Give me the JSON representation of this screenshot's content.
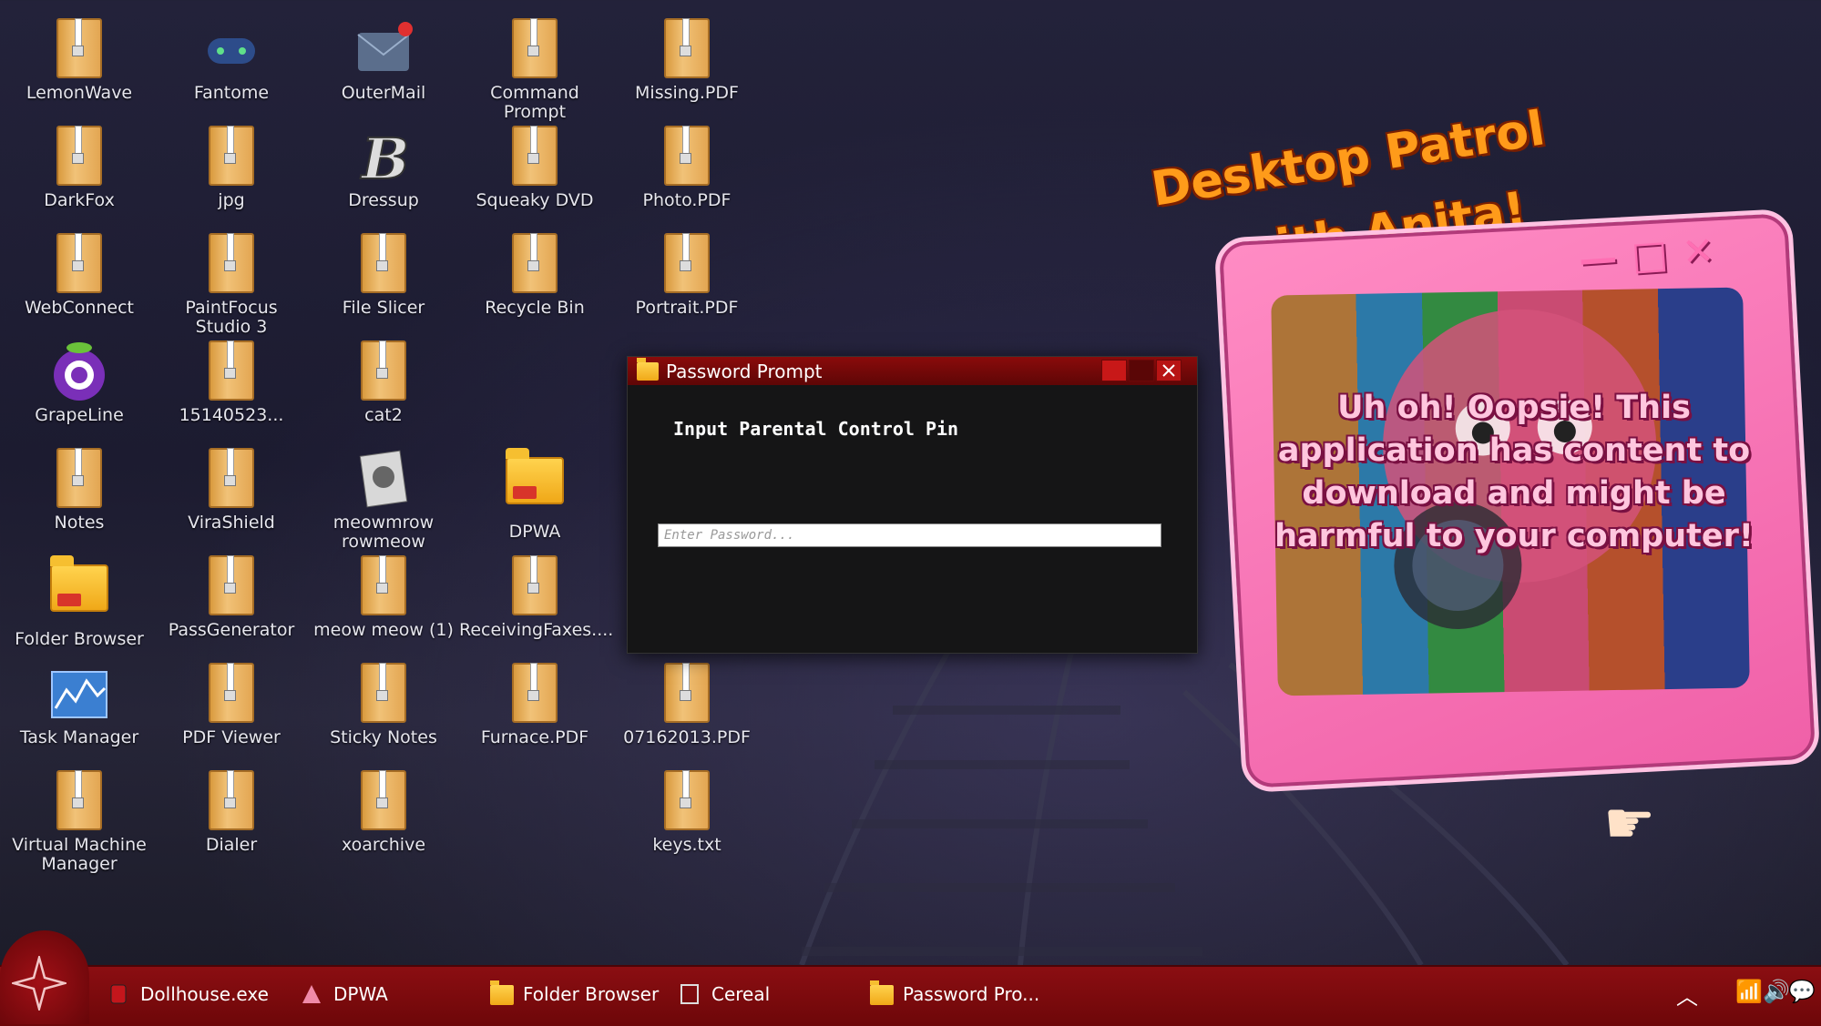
{
  "desktop": {
    "icons": [
      {
        "label": "LemonWave",
        "type": "zip"
      },
      {
        "label": "DarkFox",
        "type": "zip"
      },
      {
        "label": "WebConnect",
        "type": "zip"
      },
      {
        "label": "GrapeLine",
        "type": "grape"
      },
      {
        "label": "Notes",
        "type": "zip"
      },
      {
        "label": "Folder Browser",
        "type": "folder"
      },
      {
        "label": "Task Manager",
        "type": "taskmgr"
      },
      {
        "label": "Virtual Machine\nManager",
        "type": "zip"
      },
      {
        "label": "Fantome",
        "type": "gamepad"
      },
      {
        "label": "jpg",
        "type": "zip"
      },
      {
        "label": "PaintFocus\nStudio 3",
        "type": "zip"
      },
      {
        "label": "15140523...",
        "type": "zip"
      },
      {
        "label": "ViraShield",
        "type": "zip"
      },
      {
        "label": "PassGenerator",
        "type": "zip"
      },
      {
        "label": "PDF Viewer",
        "type": "zip"
      },
      {
        "label": "Dialer",
        "type": "zip"
      },
      {
        "label": "OuterMail",
        "type": "mail"
      },
      {
        "label": "Dressup",
        "type": "dressup"
      },
      {
        "label": "File Slicer",
        "type": "zip"
      },
      {
        "label": "cat2",
        "type": "zip"
      },
      {
        "label": "meowmrow\nrowmeow",
        "type": "photo"
      },
      {
        "label": "meow meow (1)",
        "type": "zip"
      },
      {
        "label": "Sticky Notes",
        "type": "zip"
      },
      {
        "label": "xoarchive",
        "type": "zip"
      },
      {
        "label": "Command\nPrompt",
        "type": "zip"
      },
      {
        "label": "Squeaky DVD",
        "type": "zip"
      },
      {
        "label": "Recycle Bin",
        "type": "zip"
      },
      {
        "label": "DPWA",
        "type": "folder"
      },
      {
        "label": "ReceivingFaxes....",
        "type": "zip"
      },
      {
        "label": "Furnace.PDF",
        "type": "zip"
      },
      {
        "label": "Missing.PDF",
        "type": "zip"
      },
      {
        "label": "Photo.PDF",
        "type": "zip"
      },
      {
        "label": "Portrait.PDF",
        "type": "zip"
      },
      {
        "label": "07162013.PDF",
        "type": "zip"
      },
      {
        "label": "keys.txt",
        "type": "zip"
      }
    ]
  },
  "dialog": {
    "title": "Password Prompt",
    "heading": "Input Parental Control Pin",
    "input_placeholder": "Enter Password...",
    "input_value": ""
  },
  "anita": {
    "title_line1": "Desktop Patrol",
    "title_line2": "with Anita!",
    "message": "Uh oh! Oopsie! This application has content to download and might be harmful to your computer!"
  },
  "taskbar": {
    "items": [
      {
        "label": "Dollhouse.exe",
        "icon": "dollhouse-icon"
      },
      {
        "label": "DPWA",
        "icon": "dpwa-icon"
      },
      {
        "label": "Folder Browser",
        "icon": "folder-icon"
      },
      {
        "label": "Cereal",
        "icon": "cereal-icon"
      },
      {
        "label": "Password Pro...",
        "icon": "folder-icon"
      }
    ]
  },
  "colors": {
    "taskbar": "#7b0a0d",
    "dialog_title": "#7a0a0a",
    "anita_frame": "#f270b0",
    "anita_title": "#ff9b1a"
  }
}
